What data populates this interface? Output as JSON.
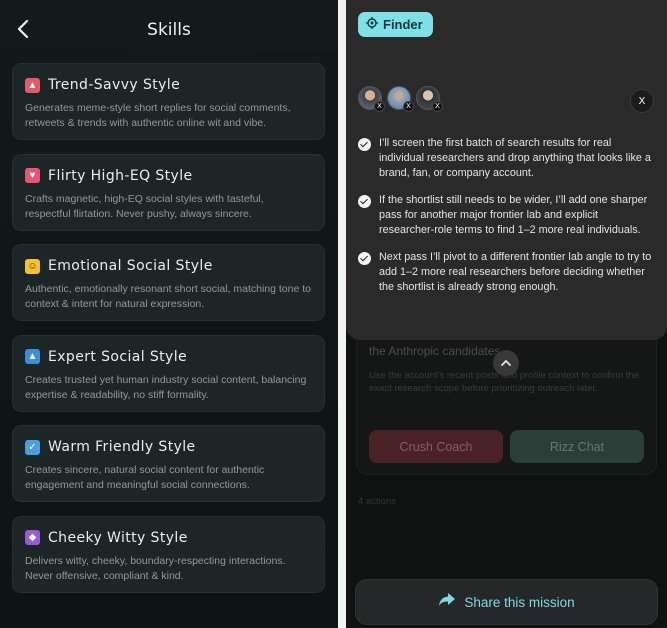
{
  "left": {
    "title": "Skills",
    "cards": [
      {
        "title": "Trend-Savvy Style",
        "emoji_color": "#e05a6a",
        "emoji": "▲",
        "description": "Generates meme-style short replies for social comments, retweets & trends with authentic online wit and vibe."
      },
      {
        "title": "Flirty High-EQ Style",
        "emoji_color": "#e8547a",
        "emoji": "♥",
        "description": "Crafts magnetic, high-EQ social styles with tasteful, respectful flirtation. Never pushy, always sincere."
      },
      {
        "title": "Emotional Social Style",
        "emoji_color": "#f2c230",
        "emoji": "☺",
        "description": "Authentic, emotionally resonant short social, matching tone to context & intent for natural expression."
      },
      {
        "title": "Expert Social Style",
        "emoji_color": "#3a8fd6",
        "emoji": "▲",
        "description": "Creates trusted yet human industry social content, balancing expertise & readability, no stiff formality."
      },
      {
        "title": "Warm Friendly Style",
        "emoji_color": "#4a9fe0",
        "emoji": "✓",
        "description": "Creates sincere, natural social content for authentic engagement and meaningful social connections."
      },
      {
        "title": "Cheeky Witty Style",
        "emoji_color": "#9a5ad8",
        "emoji": "◆",
        "description": "Delivers witty, cheeky, boundary-respecting interactions. Never offensive, compliant & kind."
      }
    ]
  },
  "right": {
    "finder_label": "Finder",
    "x_icon": "X",
    "steps": [
      "I’ll screen the first batch of search results for real individual researchers and drop anything that looks like a brand, fan, or company account.",
      "If the shortlist still needs to be wider, I’ll add one sharper pass for another major frontier lab and explicit researcher-role terms to find 1–2 more real individuals.",
      "Next pass I’ll pivot to a different frontier lab angle to try to add 1–2 more real researchers before deciding whether the shortlist is already strong enough."
    ],
    "background": {
      "line1": "the Anthropic candidates.",
      "line2": "Use the account's recent posts and profile context to confirm the exact research scope before prioritizing outreach later.",
      "button1": "Crush Coach",
      "button2": "Rizz Chat",
      "actions": "4 actions"
    },
    "share_label": "Share this mission",
    "colors": {
      "accent": "#7fe0e6",
      "share_text": "#7fd6ea"
    }
  }
}
